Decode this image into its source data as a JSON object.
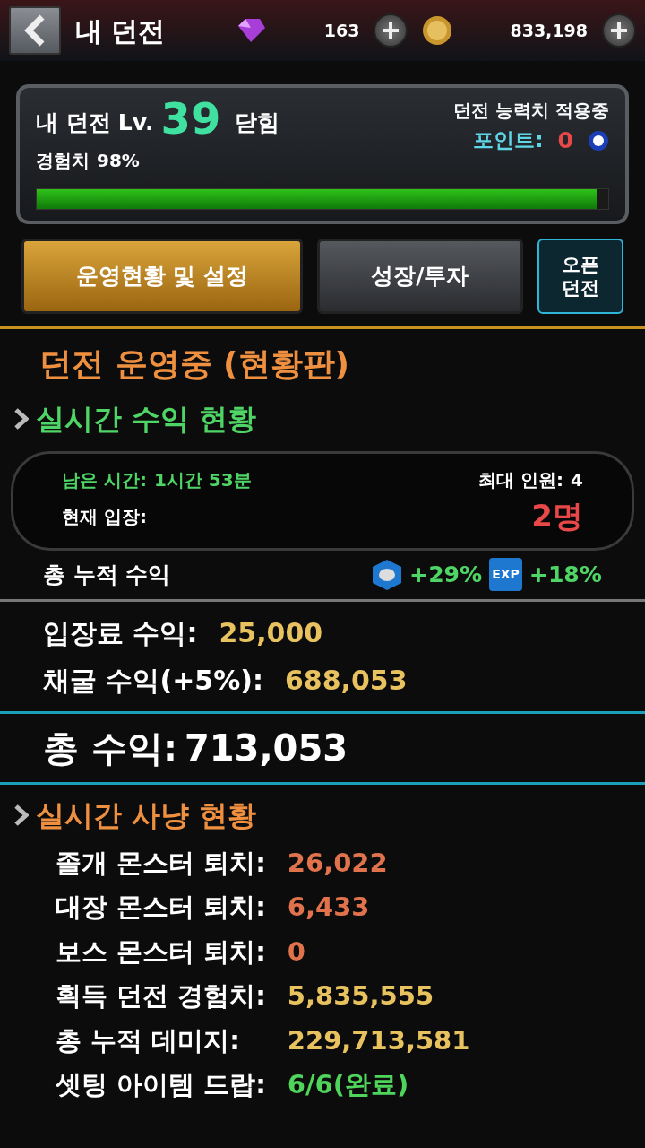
{
  "header": {
    "title": "내 던전",
    "gems": "163",
    "gold": "833,198"
  },
  "dungeon": {
    "name": "내 던전",
    "lv_label": "Lv.",
    "level_number": "39",
    "door": "닫힘",
    "exp_label": "경험치",
    "exp_value": "98%",
    "level": 0.98,
    "ability": "던전 능력치 적용중",
    "points_label": "포인트:",
    "points": "0"
  },
  "tabs": [
    {
      "label": "운영현황 및 설정",
      "selected": true
    },
    {
      "label": "성장/투자",
      "selected": false
    }
  ],
  "open_button": "오픈 던전",
  "status_title": "던전 운영중 (현황판)",
  "income": {
    "heading": "실시간 수익 현황",
    "remaining_label": "남은 시간:",
    "remaining": "1시간 53분",
    "max_label": "최대 인원:",
    "max": "4",
    "current_label": "현재 입장:",
    "current": "2명",
    "accum_label": "총 누적 수익",
    "coin_bonus": "+29%",
    "exp_badge": "EXP",
    "exp_bonus": "+18%",
    "rows": [
      {
        "label": "입장료 수익:",
        "value": "25,000"
      },
      {
        "label": "채굴 수익(+**5**%):",
        "value": "688,053"
      }
    ],
    "total_label": "총 수익:",
    "total": "713,053"
  },
  "hunt": {
    "heading": "실시간 사냥 현황",
    "rows": [
      {
        "label": "졸개 몬스터 퇴치:",
        "value": "26,022",
        "color": "#e0734c"
      },
      {
        "label": "대장 몬스터 퇴치:",
        "value": "6,433",
        "color": "#e0734c"
      },
      {
        "label": "보스 몬스터 퇴치:",
        "value": "0",
        "color": "#e0734c"
      },
      {
        "label": "획득 던전 경험치:",
        "value": "5,835,555",
        "color": "#e8c25e"
      },
      {
        "label": "총 누적 데미지:",
        "value": "229,713,581",
        "color": "#e8c25e"
      },
      {
        "label": "셋팅 아이템 드랍:",
        "value": "6/6(완료)",
        "color": "#4fd45c"
      }
    ]
  }
}
